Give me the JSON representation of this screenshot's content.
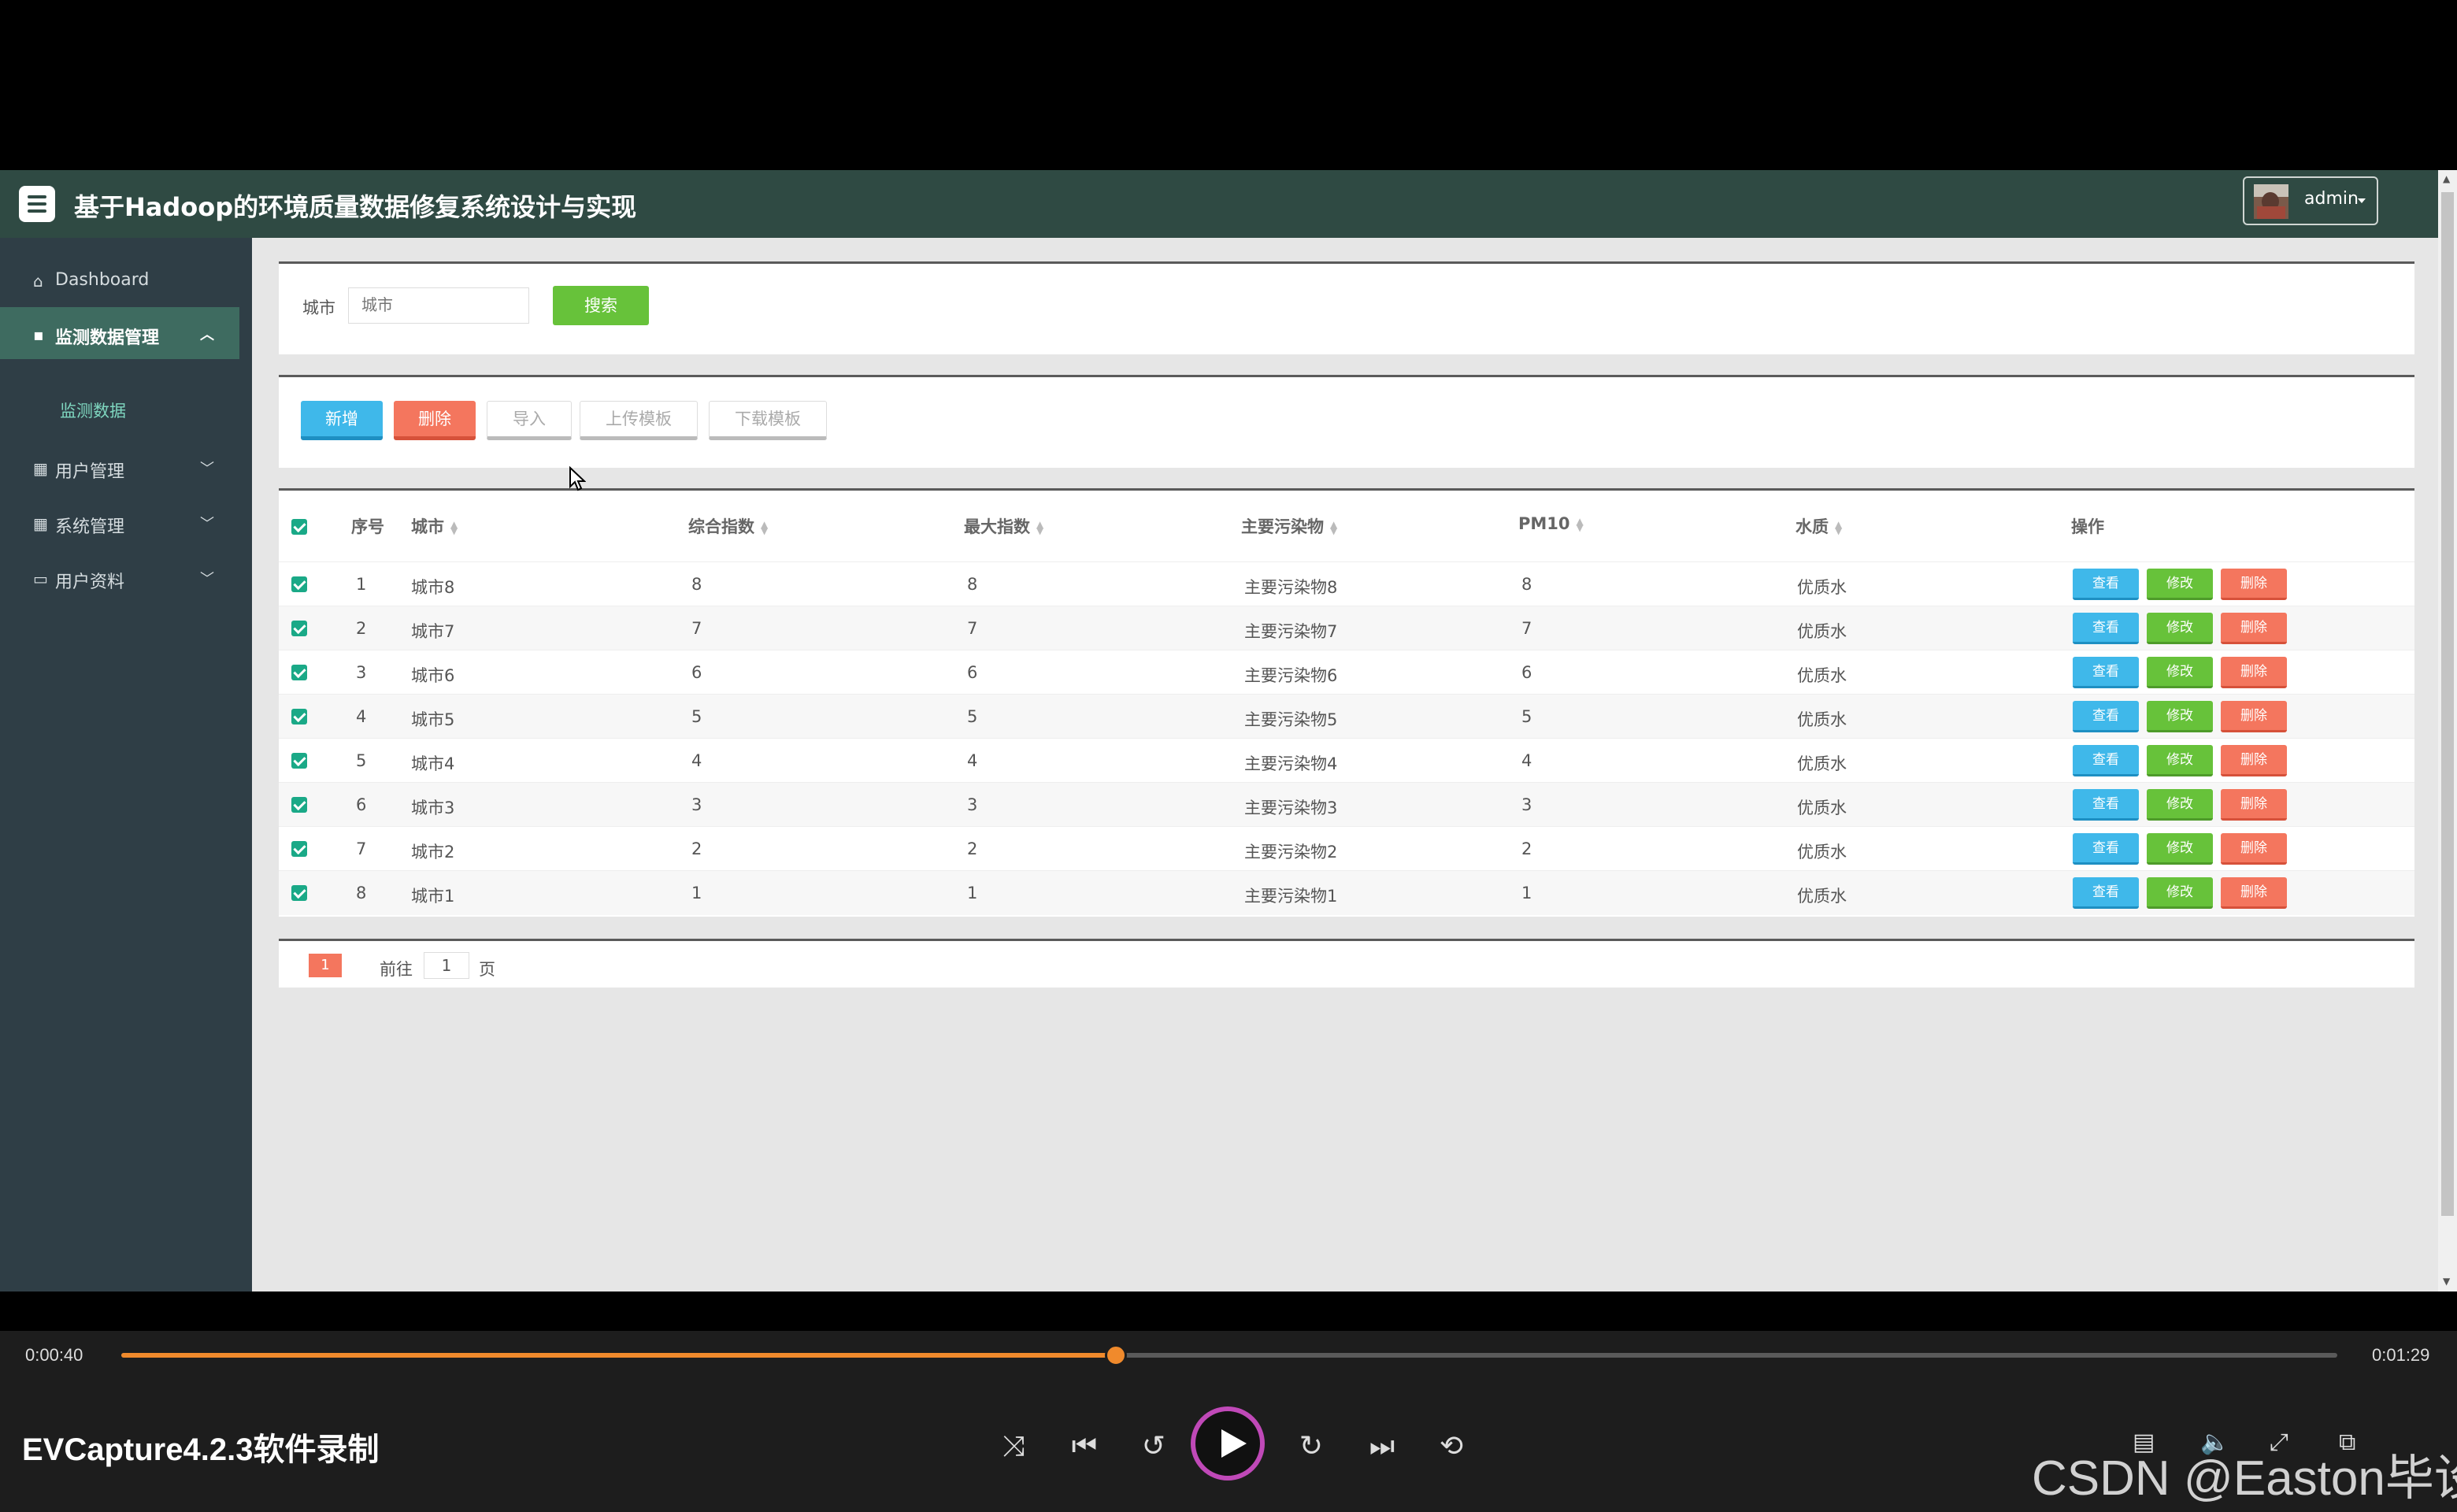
{
  "header": {
    "title": "基于Hadoop的环境质量数据修复系统设计与实现",
    "user": "admin"
  },
  "sidebar": {
    "items": [
      {
        "label": "Dashboard",
        "icon": "home-icon"
      },
      {
        "label": "监测数据管理",
        "icon": "comment-icon",
        "active": true
      },
      {
        "label": "用户管理",
        "icon": "grid-icon"
      },
      {
        "label": "系统管理",
        "icon": "grid-icon"
      },
      {
        "label": "用户资料",
        "icon": "card-icon"
      }
    ],
    "sub_item": "监测数据"
  },
  "search": {
    "label": "城市",
    "placeholder": "城市",
    "button": "搜索"
  },
  "toolbar": {
    "add": "新增",
    "delete": "删除",
    "import": "导入",
    "upload_template": "上传模板",
    "download_template": "下载模板"
  },
  "table": {
    "columns": [
      "序号",
      "城市",
      "综合指数",
      "最大指数",
      "主要污染物",
      "PM10",
      "水质",
      "操作"
    ],
    "rows": [
      {
        "no": "1",
        "city": "城市8",
        "composite": "8",
        "max": "8",
        "pollutant": "主要污染物8",
        "pm10": "8",
        "water": "优质水"
      },
      {
        "no": "2",
        "city": "城市7",
        "composite": "7",
        "max": "7",
        "pollutant": "主要污染物7",
        "pm10": "7",
        "water": "优质水"
      },
      {
        "no": "3",
        "city": "城市6",
        "composite": "6",
        "max": "6",
        "pollutant": "主要污染物6",
        "pm10": "6",
        "water": "优质水"
      },
      {
        "no": "4",
        "city": "城市5",
        "composite": "5",
        "max": "5",
        "pollutant": "主要污染物5",
        "pm10": "5",
        "water": "优质水"
      },
      {
        "no": "5",
        "city": "城市4",
        "composite": "4",
        "max": "4",
        "pollutant": "主要污染物4",
        "pm10": "4",
        "water": "优质水"
      },
      {
        "no": "6",
        "city": "城市3",
        "composite": "3",
        "max": "3",
        "pollutant": "主要污染物3",
        "pm10": "3",
        "water": "优质水"
      },
      {
        "no": "7",
        "city": "城市2",
        "composite": "2",
        "max": "2",
        "pollutant": "主要污染物2",
        "pm10": "2",
        "water": "优质水"
      },
      {
        "no": "8",
        "city": "城市1",
        "composite": "1",
        "max": "1",
        "pollutant": "主要污染物1",
        "pm10": "1",
        "water": "优质水"
      }
    ],
    "actions": {
      "view": "查看",
      "edit": "修改",
      "delete": "删除"
    }
  },
  "pagination": {
    "current": "1",
    "goto_prefix": "前往",
    "goto_value": "1",
    "goto_suffix": "页"
  },
  "player": {
    "elapsed": "0:00:40",
    "total": "0:01:29",
    "progress": 0.449,
    "brand": "EVCapture4.2.3软件录制",
    "watermark": "CSDN @Easton毕设"
  },
  "colors": {
    "header": "#2f4a43",
    "sidebar": "#2f3e46",
    "sidebar_active": "#3e6b60",
    "accent_orange": "#f08a2c",
    "btn_blue": "#3fb8ea",
    "btn_green": "#67c23a",
    "btn_red": "#f4765e"
  }
}
